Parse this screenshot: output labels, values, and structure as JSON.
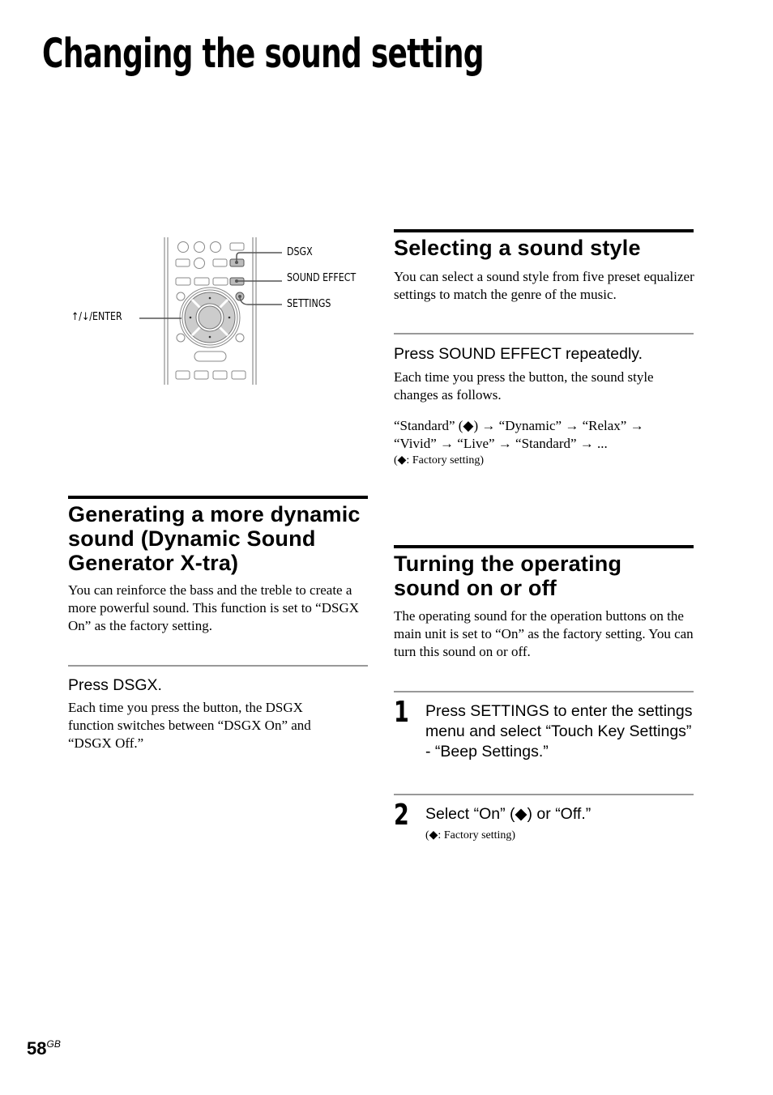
{
  "page_title": "Changing the sound setting",
  "remote_figure": {
    "callouts": {
      "dsgx": "DSGX",
      "sound_effect": "SOUND EFFECT",
      "settings": "SETTINGS",
      "enter": "↑/↓/ENTER"
    }
  },
  "section_sound_style": {
    "heading": "Selecting a sound style",
    "intro": "You can select a sound style from five preset equalizer settings to match the genre of the music.",
    "step_label": "Press SOUND EFFECT repeatedly.",
    "step_desc": "Each time you press the button, the sound style changes as follows.",
    "sequence_line1": "“Standard” (◆) → “Dynamic” → “Relax” →",
    "sequence_line2": "“Vivid” → “Live” → “Standard” → ...",
    "note": "(◆: Factory setting)"
  },
  "section_dsgx": {
    "heading": "Generating a more dynamic sound (Dynamic Sound Generator X-tra)",
    "intro": "You can reinforce the bass and the treble to create a more powerful sound. This function is set to “DSGX On” as the factory setting.",
    "step_label": "Press DSGX.",
    "step_desc": "Each time you press the button, the DSGX function switches between “DSGX On” and “DSGX Off.”"
  },
  "section_operating_sound": {
    "heading": "Turning the operating sound on or off",
    "intro": "The operating sound for the operation buttons on the main unit is set to “On” as the factory setting. You can turn this sound on or off.",
    "steps": [
      {
        "number": "1",
        "text": "Press SETTINGS to enter the settings menu and select “Touch Key Settings” - “Beep Settings.”"
      },
      {
        "number": "2",
        "text": "Select “On” (◆) or “Off.”",
        "note": "(◆: Factory setting)"
      }
    ]
  },
  "footer": {
    "page_number": "58",
    "region": "GB"
  }
}
